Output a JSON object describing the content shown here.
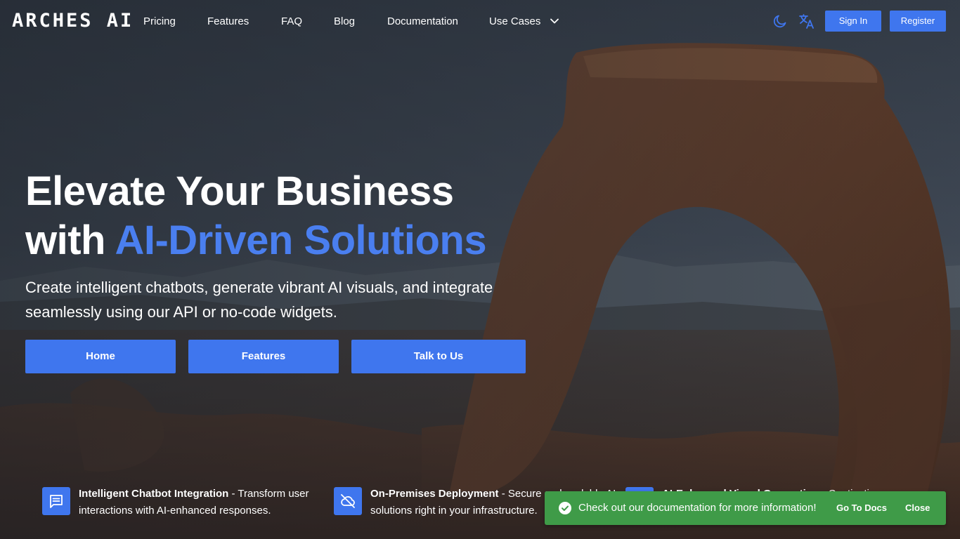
{
  "brand": {
    "logo_text": "ARCHES AI"
  },
  "nav": {
    "items": [
      {
        "label": "Pricing"
      },
      {
        "label": "Features"
      },
      {
        "label": "FAQ"
      },
      {
        "label": "Blog"
      },
      {
        "label": "Documentation"
      },
      {
        "label": "Use Cases",
        "icon": "chevron-down-icon"
      }
    ]
  },
  "header_actions": {
    "theme_icon": "moon-icon",
    "language_icon": "translate-icon",
    "sign_in_label": "Sign In",
    "register_label": "Register"
  },
  "hero": {
    "title_line1": "Elevate Your Business",
    "title_line2_prefix": "with ",
    "title_line2_accent": "AI-Driven Solutions",
    "subtitle": "Create intelligent chatbots, generate vibrant AI visuals, and integrate seamlessly using our API or no-code widgets.",
    "buttons": [
      {
        "label": "Home"
      },
      {
        "label": "Features"
      },
      {
        "label": "Talk to Us"
      }
    ]
  },
  "features": [
    {
      "icon": "chat-icon",
      "title": "Intelligent Chatbot Integration",
      "separator": " - ",
      "description_line1": "Transform user",
      "description_line2": "interactions with AI-enhanced responses."
    },
    {
      "icon": "cloud-off-icon",
      "title": "On-Premises Deployment",
      "separator": " - ",
      "description_line1": "Secure and scalable AI",
      "description_line2": "solutions right in your infrastructure."
    },
    {
      "icon": "image-icon",
      "title": "AI-Enhanced Visual Generation",
      "separator": " - ",
      "description_line1": "Captivating",
      "description_line2": ""
    }
  ],
  "toast": {
    "icon": "check-circle-icon",
    "message": "Check out our documentation for more information!",
    "go_to_docs_label": "Go To Docs",
    "close_label": "Close"
  },
  "colors": {
    "accent": "#3f76ee",
    "accent_text": "#4a7ff0",
    "toast_bg": "#3f9b48"
  }
}
